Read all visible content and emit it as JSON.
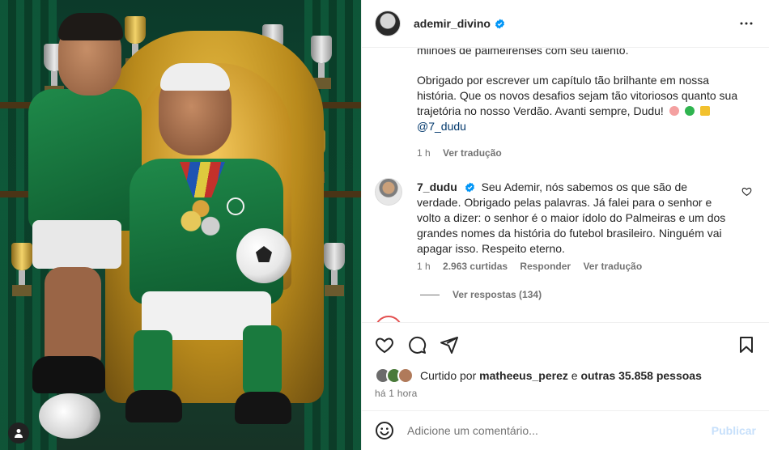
{
  "post": {
    "username": "ademir_divino",
    "verified_icon": "verified-badge-icon",
    "caption": {
      "paragraph1": "milhões de palmeirenses com seu talento.",
      "paragraph2_text": "Obrigado por escrever um capítulo tão brilhante em nossa história. Que os novos desafios sejam tão vitoriosos quanto sua trajetória no nosso Verdão. Avanti sempre, Dudu!",
      "mention": "@7_dudu",
      "emojis": [
        "pig-emoji",
        "green-heart-emoji",
        "crown-emoji"
      ],
      "time": "1 h",
      "translate": "Ver tradução"
    },
    "comment": {
      "username": "7_dudu",
      "text": "Seu Ademir, nós sabemos os que são de verdade. Obrigado pelas palavras. Já falei para o senhor e volto a dizer: o senhor é o maior ídolo do Palmeiras e um dos grandes nomes da história do futebol brasileiro. Ninguém vai apagar isso. Respeito eterno.",
      "time": "1 h",
      "likes": "2.963 curtidas",
      "reply": "Responder",
      "translate": "Ver tradução",
      "view_replies": "Ver respostas (134)"
    },
    "likes": {
      "prefix": "Curtido por",
      "user": "matheeus_perez",
      "connector": "e",
      "others": "outras 35.858 pessoas"
    },
    "timestamp": "há 1 hora",
    "add_comment": {
      "placeholder": "Adicione um comentário...",
      "publish": "Publicar"
    }
  },
  "colors": {
    "verified": "#0095f6",
    "mention": "#00376b",
    "muted": "#737373",
    "publish_disabled": "#c7e0fb",
    "palmeiras_green": "#1f8a4a"
  }
}
